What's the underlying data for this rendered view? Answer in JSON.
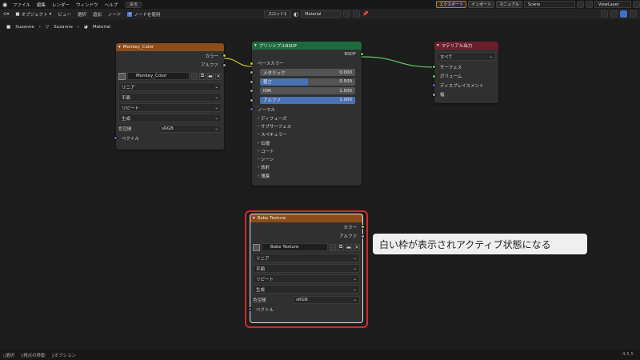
{
  "menubar": {
    "items": [
      "ファイル",
      "編集",
      "レンダー",
      "ウィンドウ",
      "ヘルプ"
    ],
    "back_label": "戻る",
    "export_label": "エクスポート",
    "import_label": "インポート",
    "manual_label": "マニュアル",
    "scene_label": "Scene",
    "viewlayer_label": "ViewLayer"
  },
  "header": {
    "mode_label": "オブジェクト",
    "view_label": "ビュー",
    "select_label": "選択",
    "add_label": "追加",
    "node_label": "ノード",
    "use_nodes_label": "ノードを使用",
    "slot_label": "スロット1",
    "material_label": "Material"
  },
  "breadcrumb": [
    "Suzanne",
    "Suzanne",
    "Material"
  ],
  "nodes": {
    "monkey": {
      "title": "Monkey_Color",
      "out_color": "カラー",
      "out_alpha": "アルファ",
      "image": "Monkey_Color",
      "interp": "リニア",
      "proj": "平面",
      "ext": "リピート",
      "source": "生成",
      "cs_label": "色空間",
      "cs_value": "sRGB",
      "vector": "ベクトル"
    },
    "bsdf": {
      "title": "プリンシプルBSDF",
      "out": "BSDF",
      "base_color": "ベースカラー",
      "metallic": "メタリック",
      "metallic_val": "0.000",
      "rough": "粗さ",
      "rough_val": "0.500",
      "ior": "IOR",
      "ior_val": "1.500",
      "alpha": "アルファ",
      "alpha_val": "1.000",
      "normal": "ノーマル",
      "panels": [
        "ディフューズ",
        "サブサーフェス",
        "スペキュラー",
        "伝播",
        "コート",
        "シーン",
        "放射",
        "薄膜"
      ]
    },
    "output": {
      "title": "マテリアル出力",
      "target": "すべて",
      "surface": "サーフェス",
      "volume": "ボリューム",
      "disp": "ディスプレイスメント",
      "thickness": "幅"
    },
    "bake": {
      "title": "Bake Texture",
      "out_color": "カラー",
      "out_alpha": "アルファ",
      "image": "Bake Texture",
      "interp": "リニア",
      "proj": "平面",
      "ext": "リピート",
      "source": "生成",
      "cs_label": "色空間",
      "cs_value": "sRGB",
      "vector": "ベクトル"
    }
  },
  "callout": "白い枠が表示されアクティブ状態になる",
  "status": {
    "select": "選択",
    "pan": "視点の移動",
    "options": "オプション",
    "version": "4.5.5"
  },
  "roughness_fraction": 0.5,
  "colors": {
    "highlight": "#d02a2a",
    "accent": "#4772b3"
  }
}
